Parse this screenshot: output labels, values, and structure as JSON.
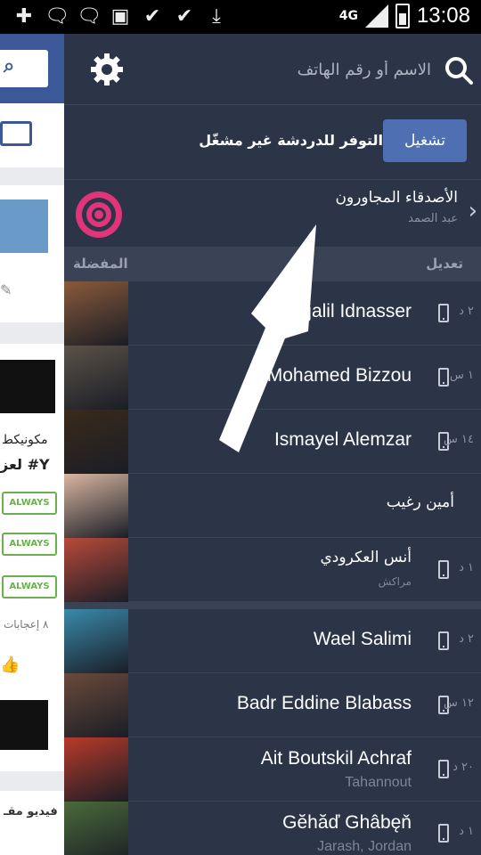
{
  "status_bar": {
    "network": "4G",
    "time": "13:08",
    "icons": [
      "add-friend-icon",
      "messenger-icon",
      "messenger-icon",
      "image-icon",
      "check-icon",
      "check-icon",
      "download-icon"
    ]
  },
  "background_page": {
    "always_label": "ALWAYS",
    "text_line1": "مكونيكط",
    "text_line2": "لعز #Y",
    "likes_text": "٨ إعجابات",
    "video_text": "فيديو مقـ",
    "search_hint": "ب"
  },
  "drawer": {
    "search": {
      "placeholder": "الاسم أو رقم الهاتف"
    },
    "availability": {
      "text": "التوفر للدردشة غير مشغّل",
      "button_label": "تشغيل"
    },
    "nearby": {
      "title": "الأصدقاء المجاورون",
      "subtitle": "عبد الصمد"
    },
    "favorites_header": {
      "left": "المفضلة",
      "right": "تعديل"
    },
    "favorites": [
      {
        "name": "Abdeljalil Idnasser",
        "time": "٢ د",
        "mobile": true,
        "avatar_color": "#8a5a3a"
      },
      {
        "name": "Mohamed Bizzou",
        "time": "١ س",
        "mobile": true,
        "avatar_color": "#5a5248"
      },
      {
        "name": "Ismayel Alemzar",
        "time": "١٤ س",
        "mobile": true,
        "avatar_color": "#3a2a1a"
      },
      {
        "name": "أمين رغيب",
        "time": "",
        "mobile": false,
        "avatar_color": "#d9b6a0"
      },
      {
        "name": "أنس العكرودي",
        "subtitle": "مراكش",
        "time": "١ د",
        "mobile": true,
        "avatar_color": "#b84a3a"
      }
    ],
    "contacts": [
      {
        "name": "Wael Salimi",
        "time": "٢ د",
        "mobile": true,
        "avatar_color": "#3a8aaa"
      },
      {
        "name": "Badr Eddine Blabass",
        "time": "١٢ س",
        "mobile": true,
        "avatar_color": "#6a4a3a"
      },
      {
        "name": "Ait Boutskil Achraf",
        "subtitle": "Tahannout",
        "time": "٢٠ د",
        "mobile": true,
        "avatar_color": "#b83a2a"
      },
      {
        "name": "Gĕhăď Ghâbęň",
        "subtitle": "Jarash, Jordan",
        "time": "١ د",
        "mobile": true,
        "avatar_color": "#4a6a3a"
      }
    ]
  }
}
